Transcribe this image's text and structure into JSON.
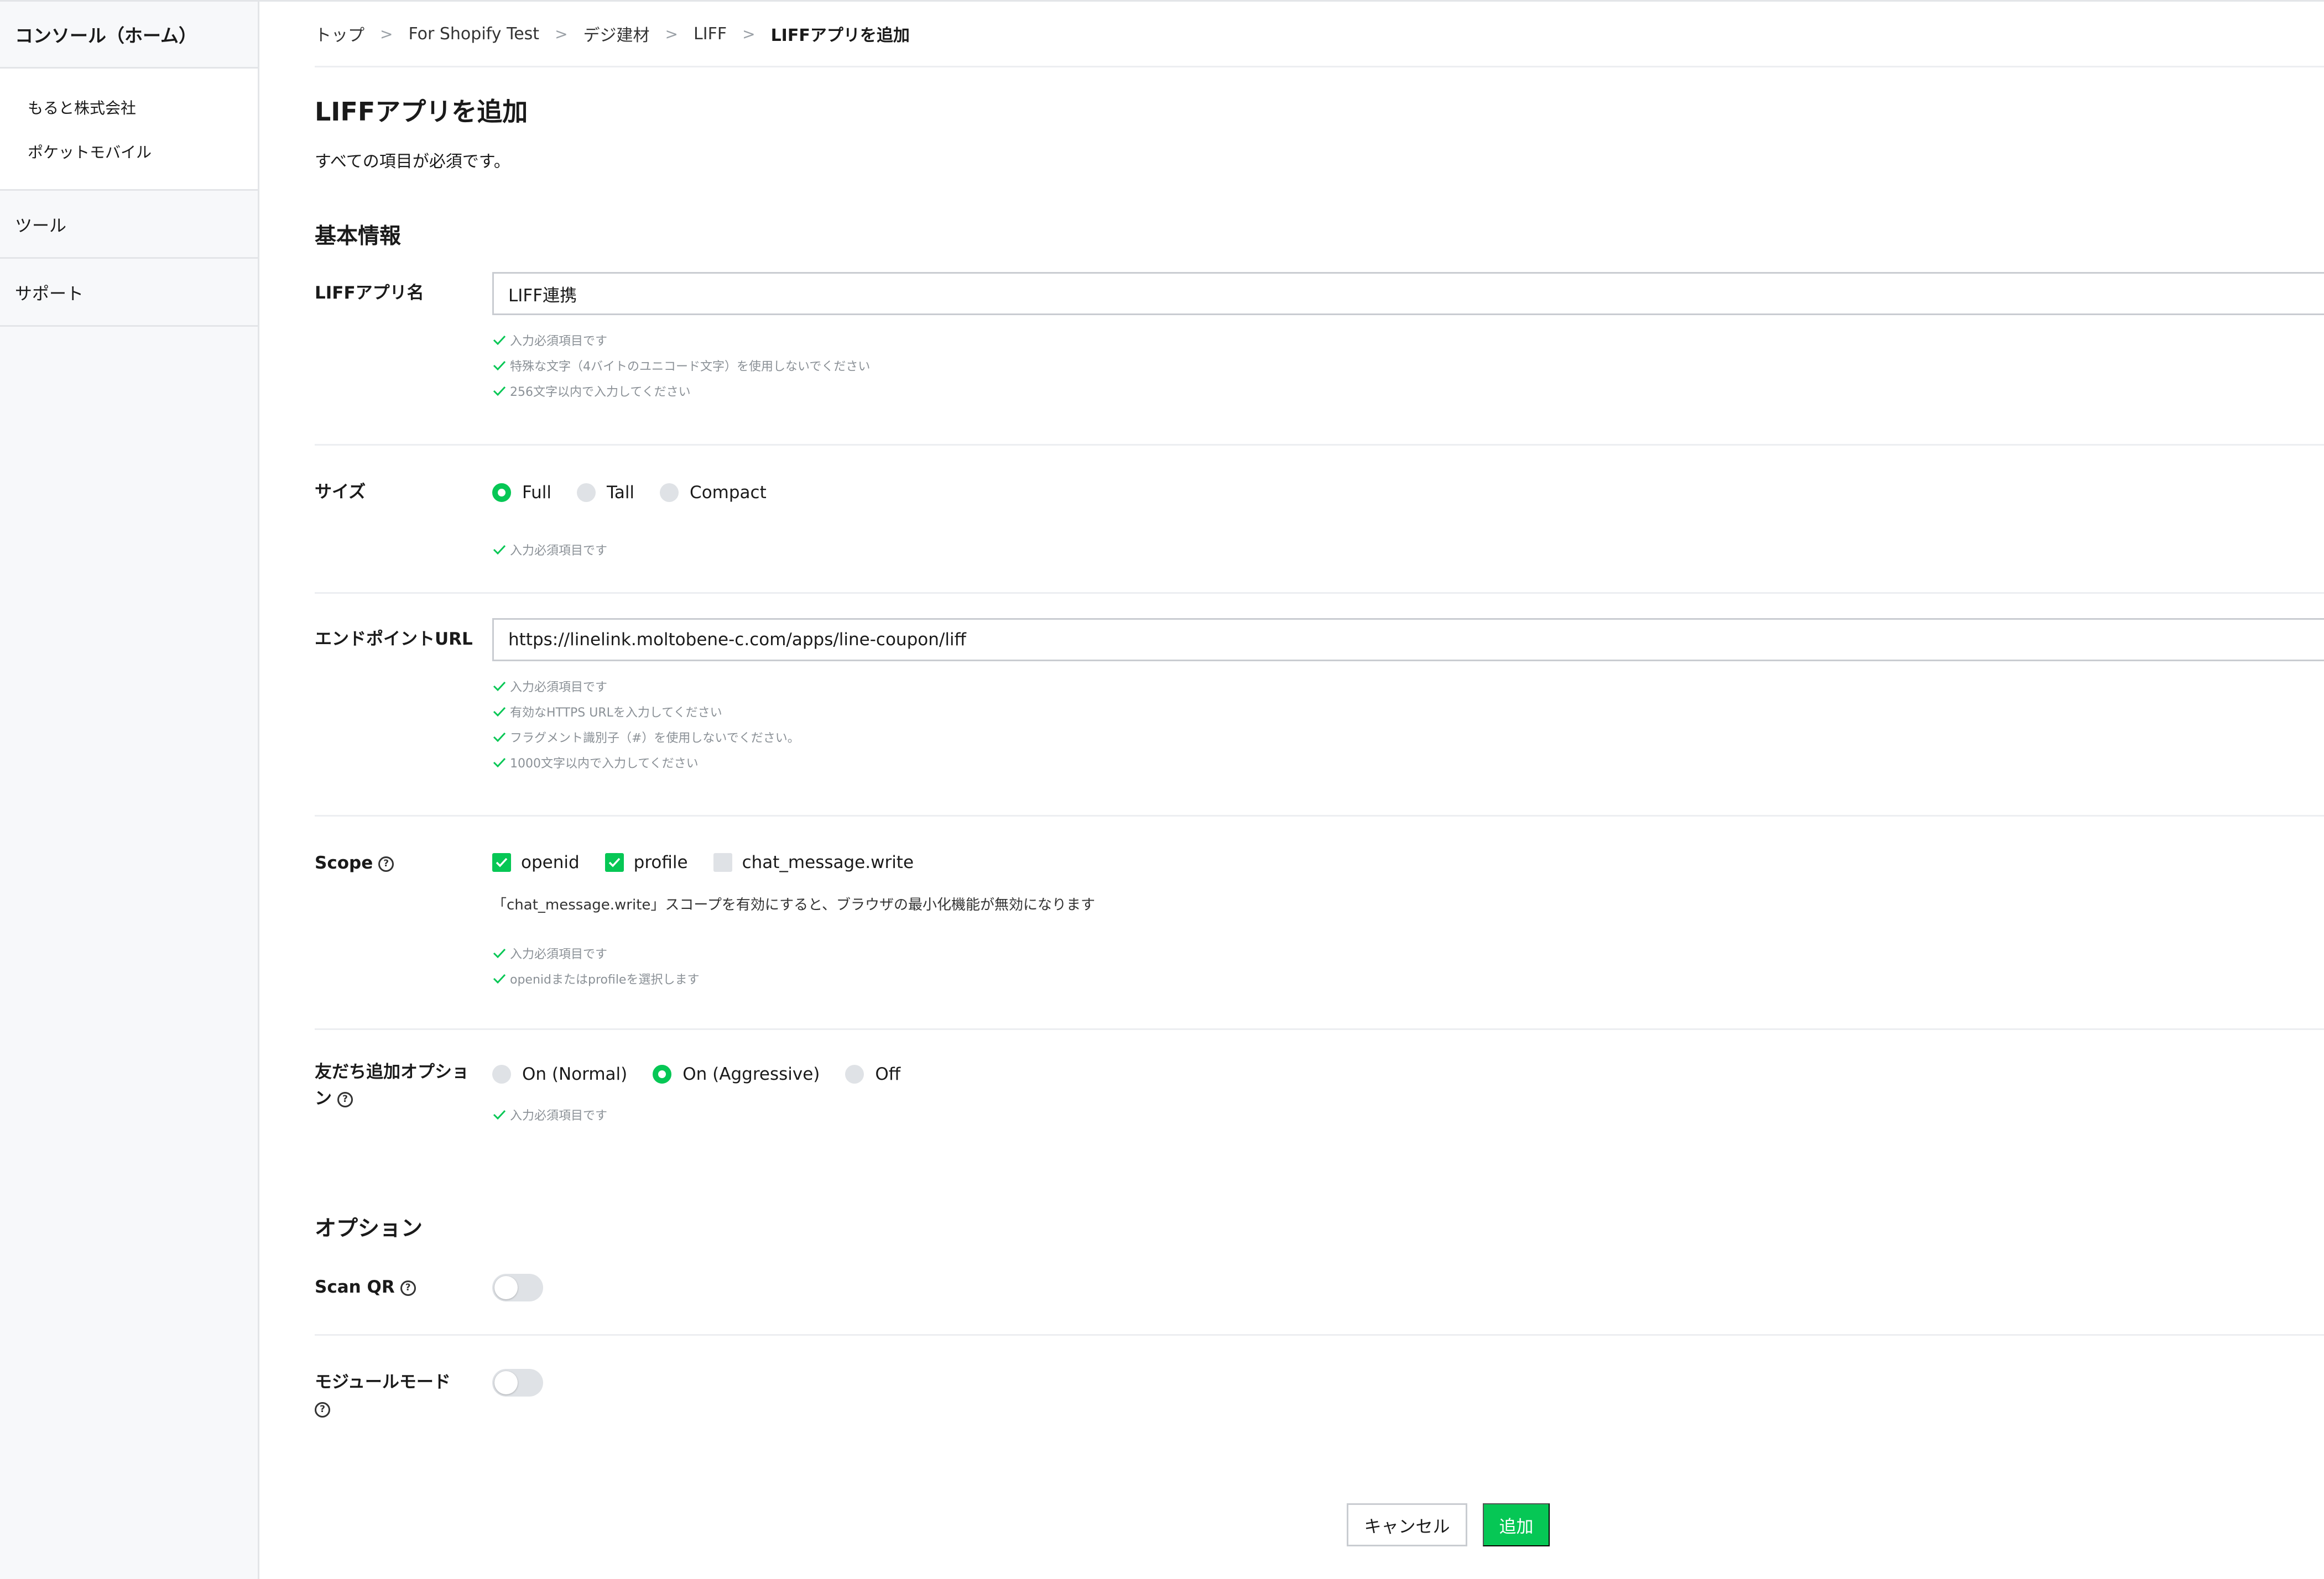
{
  "sidebar": {
    "home": "コンソール（ホーム）",
    "providers": [
      "もると株式会社",
      "ポケットモバイル"
    ],
    "tools": "ツール",
    "support": "サポート"
  },
  "breadcrumb": [
    "トップ",
    "For Shopify Test",
    "デジ建材",
    "LIFF",
    "LIFFアプリを追加"
  ],
  "page": {
    "title": "LIFFアプリを追加",
    "description": "すべての項目が必須です。"
  },
  "sections": {
    "basic": "基本情報",
    "options": "オプション"
  },
  "fields": {
    "app_name": {
      "label": "LIFFアプリ名",
      "value": "LIFF連携",
      "hints": [
        "入力必須項目です",
        "特殊な文字（4バイトのユニコード文字）を使用しないでください",
        "256文字以内で入力してください"
      ]
    },
    "size": {
      "label": "サイズ",
      "options": [
        "Full",
        "Tall",
        "Compact"
      ],
      "selected": "Full",
      "hints": [
        "入力必須項目です"
      ]
    },
    "endpoint": {
      "label": "エンドポイントURL",
      "value": "https://linelink.moltobene-c.com/apps/line-coupon/liff",
      "hints": [
        "入力必須項目です",
        "有効なHTTPS URLを入力してください",
        "フラグメント識別子（#）を使用しないでください。",
        "1000文字以内で入力してください"
      ]
    },
    "scope": {
      "label": "Scope",
      "options": [
        "openid",
        "profile",
        "chat_message.write"
      ],
      "checked": [
        "openid",
        "profile"
      ],
      "note": "「chat_message.write」スコープを有効にすると、ブラウザの最小化機能が無効になります",
      "hints": [
        "入力必須項目です",
        "openidまたはprofileを選択します"
      ]
    },
    "friendship": {
      "label_line1": "友だち追加オプショ",
      "label_line2": "ン",
      "options": [
        "On (Normal)",
        "On (Aggressive)",
        "Off"
      ],
      "selected": "On (Aggressive)",
      "hints": [
        "入力必須項目です"
      ]
    },
    "scan_qr": {
      "label": "Scan QR",
      "enabled": false
    },
    "module_mode": {
      "label": "モジュールモード",
      "enabled": false
    }
  },
  "buttons": {
    "cancel": "キャンセル",
    "add": "追加"
  },
  "icons": {
    "help": "?"
  },
  "colors": {
    "accent": "#06c755",
    "border": "#c9ccd1",
    "hint": "#8a9096"
  }
}
